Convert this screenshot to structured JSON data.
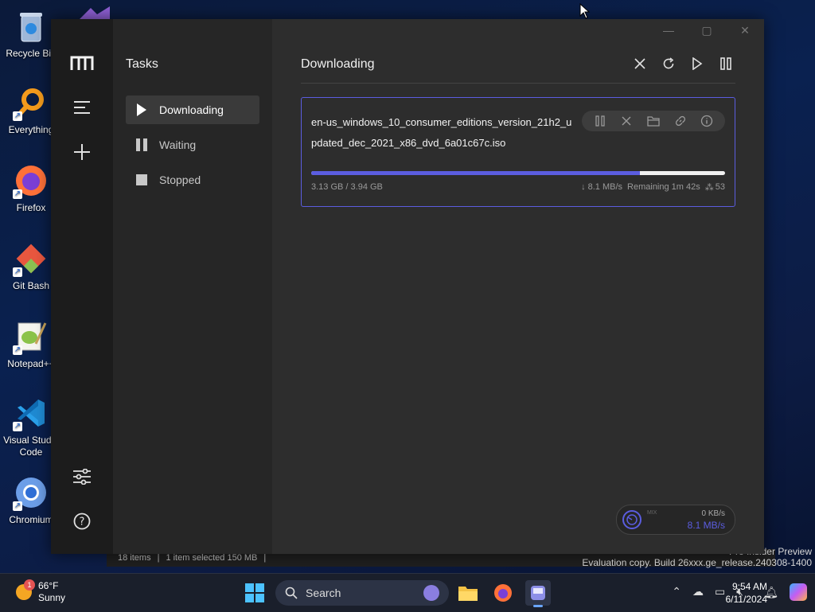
{
  "desktop": {
    "icons": [
      {
        "label": "Recycle Bin",
        "icon": "recycle-bin-icon"
      },
      {
        "label": "Everything",
        "icon": "everything-search-icon"
      },
      {
        "label": "Firefox",
        "icon": "firefox-icon"
      },
      {
        "label": "Git Bash",
        "icon": "git-bash-icon"
      },
      {
        "label": "Notepad++",
        "icon": "notepad-plus-plus-icon"
      },
      {
        "label": "Visual Studio Code",
        "icon": "vscode-icon"
      },
      {
        "label": "Chromium",
        "icon": "chromium-icon"
      }
    ],
    "background_status": {
      "items": "18 items",
      "selected": "1 item selected 150 MB"
    },
    "watermark": {
      "line1": "Pro Insider Preview",
      "line2": "Evaluation copy. Build 26xxx.ge_release.240308-1400"
    }
  },
  "app": {
    "rail_icons": [
      "motrix-logo-icon",
      "menu-icon",
      "plus-icon",
      "settings-sliders-icon",
      "help-icon"
    ],
    "sidebar": {
      "title": "Tasks",
      "items": [
        {
          "label": "Downloading",
          "icon": "play-icon",
          "active": true
        },
        {
          "label": "Waiting",
          "icon": "pause-icon",
          "active": false
        },
        {
          "label": "Stopped",
          "icon": "stop-icon",
          "active": false
        }
      ]
    },
    "main": {
      "heading": "Downloading",
      "toolbar": [
        "close-icon",
        "refresh-icon",
        "play-icon",
        "pause-icon"
      ]
    },
    "task": {
      "filename": "en-us_windows_10_consumer_editions_version_21h2_updated_dec_2021_x86_dvd_6a01c67c.iso",
      "size_progress": "3.13 GB / 3.94 GB",
      "progress_percent": 79.4,
      "speed": "↓ 8.1 MB/s",
      "remaining": "Remaining 1m 42s",
      "connections": "53",
      "actions": [
        "pause-icon",
        "delete-icon",
        "folder-icon",
        "link-icon",
        "info-icon"
      ]
    },
    "speedometer": {
      "mode_label": "MIX",
      "upload": "0 KB/s",
      "download": "8.1 MB/s"
    },
    "colors": {
      "accent": "#5b5de0"
    }
  },
  "taskbar": {
    "weather": {
      "temp": "66°F",
      "condition": "Sunny",
      "badge": "1"
    },
    "search_placeholder": "Search",
    "time": "9:54 AM",
    "date": "6/11/2024"
  }
}
